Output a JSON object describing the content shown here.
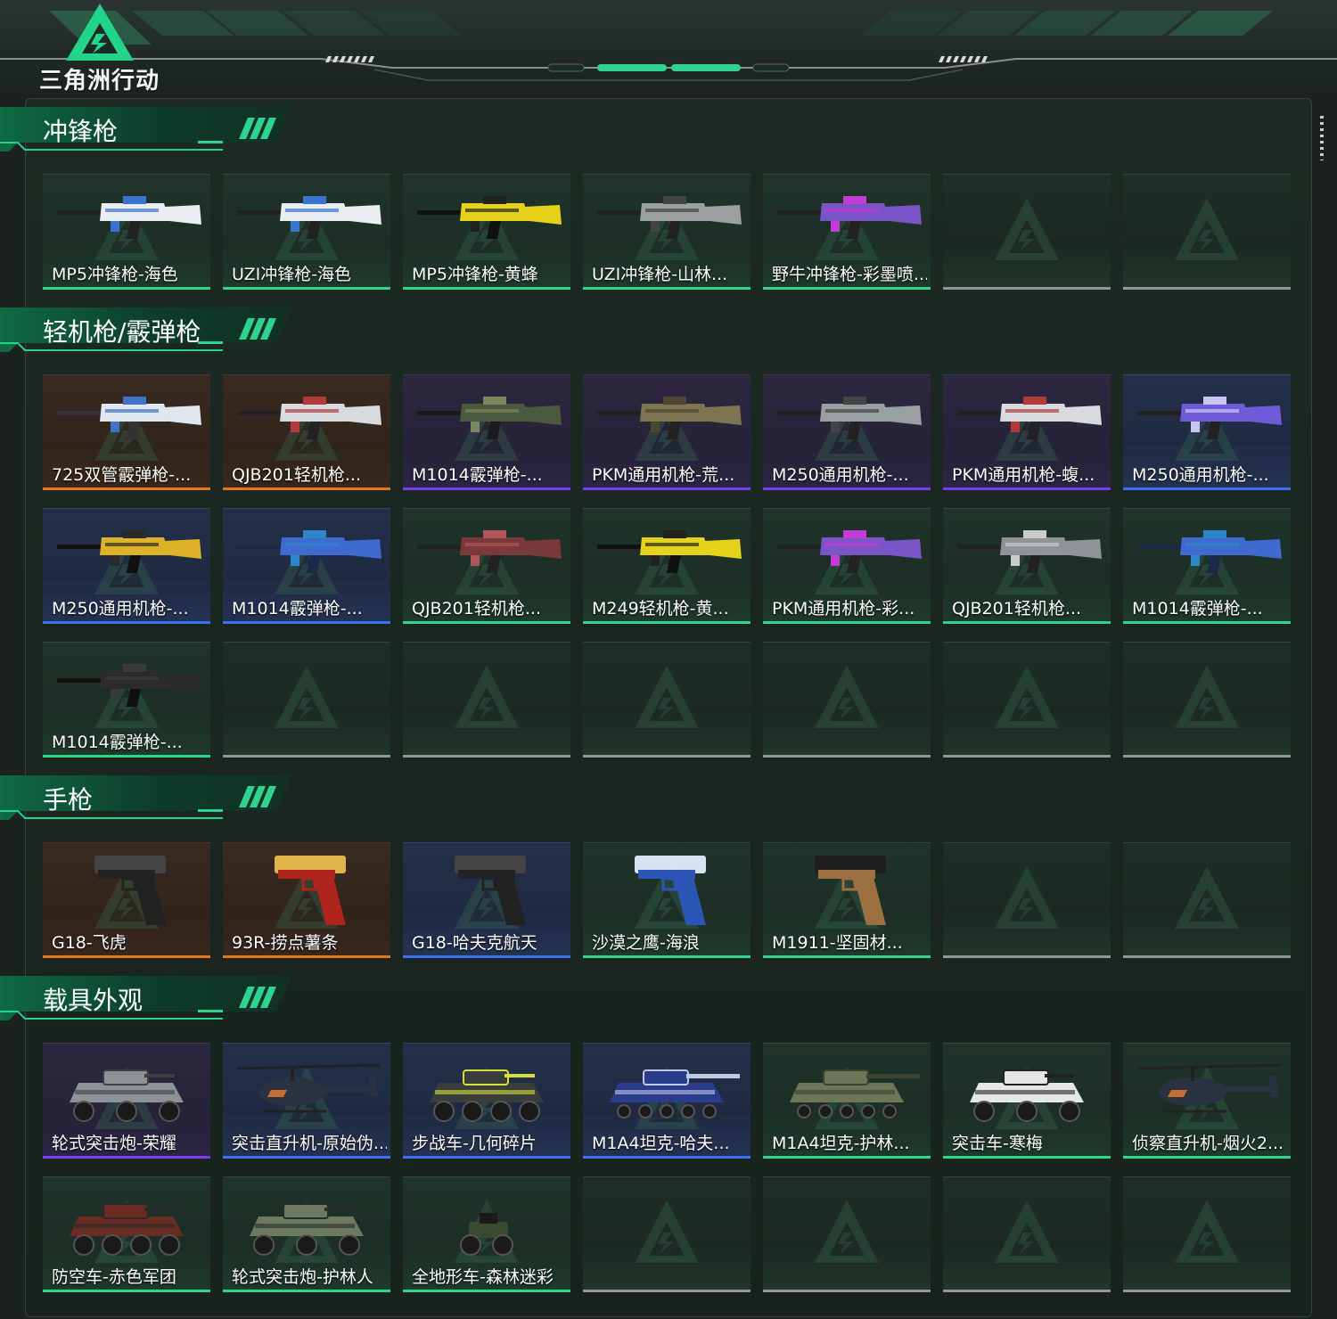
{
  "header": {
    "logo_text": "三角洲行动"
  },
  "sections": [
    {
      "title": "冲锋枪",
      "items": [
        {
          "label": "MP5冲锋枪-海色",
          "rarity": "green",
          "kind": "smg-white"
        },
        {
          "label": "UZI冲锋枪-海色",
          "rarity": "green",
          "kind": "smg-white"
        },
        {
          "label": "MP5冲锋枪-黄蜂",
          "rarity": "green",
          "kind": "rifle-yellow"
        },
        {
          "label": "UZI冲锋枪-山林...",
          "rarity": "green",
          "kind": "rifle-grey"
        },
        {
          "label": "野牛冲锋枪-彩墨喷...",
          "rarity": "green",
          "kind": "rifle-purple"
        },
        {
          "label": "",
          "rarity": "empty"
        },
        {
          "label": "",
          "rarity": "empty"
        }
      ]
    },
    {
      "title": "轻机枪/霰弹枪",
      "items": [
        {
          "label": "725双管霰弹枪-...",
          "rarity": "orange",
          "kind": "shotgun-white"
        },
        {
          "label": "QJB201轻机枪...",
          "rarity": "orange",
          "kind": "lmg-white"
        },
        {
          "label": "M1014霰弹枪-...",
          "rarity": "purple",
          "kind": "rifle-camo"
        },
        {
          "label": "PKM通用机枪-荒...",
          "rarity": "purple",
          "kind": "lmg-tan"
        },
        {
          "label": "M250通用机枪-...",
          "rarity": "purple",
          "kind": "rifle-grey"
        },
        {
          "label": "PKM通用机枪-蝮...",
          "rarity": "purple",
          "kind": "lmg-white"
        },
        {
          "label": "M250通用机枪-...",
          "rarity": "blue",
          "kind": "lmg-purple"
        },
        {
          "label": "M250通用机枪-...",
          "rarity": "blue",
          "kind": "lmg-yellow"
        },
        {
          "label": "M1014霰弹枪-...",
          "rarity": "blue",
          "kind": "shotgun-blue"
        },
        {
          "label": "QJB201轻机枪...",
          "rarity": "green",
          "kind": "rifle-red"
        },
        {
          "label": "M249轻机枪-黄...",
          "rarity": "green",
          "kind": "rifle-yellow"
        },
        {
          "label": "PKM通用机枪-彩...",
          "rarity": "green",
          "kind": "rifle-purple"
        },
        {
          "label": "QJB201轻机枪...",
          "rarity": "green",
          "kind": "lmg-grey"
        },
        {
          "label": "M1014霰弹枪-...",
          "rarity": "green",
          "kind": "shotgun-blue"
        },
        {
          "label": "M1014霰弹枪-...",
          "rarity": "green",
          "kind": "shotgun-black"
        },
        {
          "label": "",
          "rarity": "empty"
        },
        {
          "label": "",
          "rarity": "empty"
        },
        {
          "label": "",
          "rarity": "empty"
        },
        {
          "label": "",
          "rarity": "empty"
        },
        {
          "label": "",
          "rarity": "empty"
        },
        {
          "label": "",
          "rarity": "empty"
        }
      ]
    },
    {
      "title": "手枪",
      "items": [
        {
          "label": "G18-飞虎",
          "rarity": "orange",
          "kind": "pistol-black"
        },
        {
          "label": "93R-捞点薯条",
          "rarity": "orange",
          "kind": "pistol-red"
        },
        {
          "label": "G18-哈夫克航天",
          "rarity": "blue",
          "kind": "pistol-black"
        },
        {
          "label": "沙漠之鹰-海浪",
          "rarity": "green",
          "kind": "pistol-blue"
        },
        {
          "label": "M1911-坚固材...",
          "rarity": "green",
          "kind": "pistol-tan"
        },
        {
          "label": "",
          "rarity": "empty"
        },
        {
          "label": "",
          "rarity": "empty"
        }
      ]
    },
    {
      "title": "载具外观",
      "items": [
        {
          "label": "轮式突击炮-荣耀",
          "rarity": "purple",
          "kind": "vehicle-grey"
        },
        {
          "label": "突击直升机-原始伪...",
          "rarity": "blue",
          "kind": "heli-dark"
        },
        {
          "label": "步战车-几何碎片",
          "rarity": "blue",
          "kind": "apc-yellow"
        },
        {
          "label": "M1A4坦克-哈夫...",
          "rarity": "blue",
          "kind": "tank-blue"
        },
        {
          "label": "M1A4坦克-护林...",
          "rarity": "green",
          "kind": "tank-camo"
        },
        {
          "label": "突击车-寒梅",
          "rarity": "green",
          "kind": "vehicle-white"
        },
        {
          "label": "侦察直升机-烟火2...",
          "rarity": "green",
          "kind": "heli-dark"
        },
        {
          "label": "防空车-赤色军团",
          "rarity": "green",
          "kind": "apc-red"
        },
        {
          "label": "轮式突击炮-护林人",
          "rarity": "green",
          "kind": "vehicle-camo"
        },
        {
          "label": "全地形车-森林迷彩",
          "rarity": "green",
          "kind": "atv"
        },
        {
          "label": "",
          "rarity": "empty"
        },
        {
          "label": "",
          "rarity": "empty"
        },
        {
          "label": "",
          "rarity": "empty"
        },
        {
          "label": "",
          "rarity": "empty"
        }
      ]
    }
  ],
  "colors": {
    "rarity_green": "#2ed68c",
    "rarity_orange": "#e4781f",
    "rarity_purple": "#7d3cf0",
    "rarity_blue": "#3d6ff5",
    "rarity_empty": "#8f9895",
    "accent": "#1fd58b"
  }
}
